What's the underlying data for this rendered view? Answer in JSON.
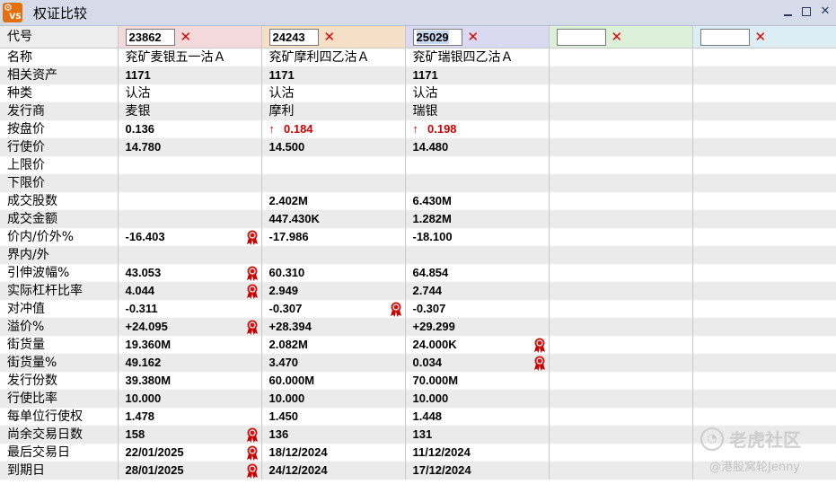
{
  "window": {
    "title": "权证比较",
    "app_icon_text": "VS"
  },
  "codes": [
    {
      "value": "23862",
      "selected": false
    },
    {
      "value": "24243",
      "selected": false
    },
    {
      "value": "25029",
      "selected": true
    },
    {
      "value": "",
      "selected": false
    },
    {
      "value": "",
      "selected": false
    }
  ],
  "code_label": "代号",
  "rows": [
    {
      "label": "名称",
      "type": "txt",
      "cells": [
        "兖矿麦银五一沽Ａ",
        "兖矿摩利四乙沽Ａ",
        "兖矿瑞银四乙沽Ａ",
        "",
        ""
      ]
    },
    {
      "label": "相关资产",
      "type": "val",
      "cells": [
        "1171",
        "1171",
        "1171",
        "",
        ""
      ]
    },
    {
      "label": "种类",
      "type": "txt",
      "cells": [
        "认沽",
        "认沽",
        "认沽",
        "",
        ""
      ]
    },
    {
      "label": "发行商",
      "type": "txt",
      "cells": [
        "麦银",
        "摩利",
        "瑞银",
        "",
        ""
      ]
    },
    {
      "label": "按盘价",
      "type": "val",
      "cells": [
        "0.136",
        "0.184",
        "0.198",
        "",
        ""
      ],
      "arrows": [
        false,
        true,
        true,
        false,
        false
      ],
      "red": [
        false,
        true,
        true,
        false,
        false
      ]
    },
    {
      "label": "行使价",
      "type": "val",
      "cells": [
        "14.780",
        "14.500",
        "14.480",
        "",
        ""
      ]
    },
    {
      "label": "上限价",
      "type": "val",
      "cells": [
        "",
        "",
        "",
        "",
        ""
      ]
    },
    {
      "label": "下限价",
      "type": "val",
      "cells": [
        "",
        "",
        "",
        "",
        ""
      ]
    },
    {
      "label": "成交股数",
      "type": "val",
      "cells": [
        "",
        "2.402M",
        "6.430M",
        "",
        ""
      ]
    },
    {
      "label": "成交金额",
      "type": "val",
      "cells": [
        "",
        "447.430K",
        "1.282M",
        "",
        ""
      ]
    },
    {
      "label": "价内/价外%",
      "type": "val",
      "cells": [
        "-16.403",
        "-17.986",
        "-18.100",
        "",
        ""
      ],
      "badges": [
        true,
        false,
        false,
        false,
        false
      ]
    },
    {
      "label": "界内/外",
      "type": "val",
      "cells": [
        "",
        "",
        "",
        "",
        ""
      ]
    },
    {
      "label": "引伸波幅%",
      "type": "val",
      "cells": [
        "43.053",
        "60.310",
        "64.854",
        "",
        ""
      ],
      "badges": [
        true,
        false,
        false,
        false,
        false
      ]
    },
    {
      "label": "实际杠杆比率",
      "type": "val",
      "cells": [
        "4.044",
        "2.949",
        "2.744",
        "",
        ""
      ],
      "badges": [
        true,
        false,
        false,
        false,
        false
      ]
    },
    {
      "label": "对冲值",
      "type": "val",
      "cells": [
        "-0.311",
        "-0.307",
        "-0.307",
        "",
        ""
      ],
      "badges": [
        false,
        true,
        false,
        false,
        false
      ]
    },
    {
      "label": "溢价%",
      "type": "val",
      "cells": [
        "+24.095",
        "+28.394",
        "+29.299",
        "",
        ""
      ],
      "badges": [
        true,
        false,
        false,
        false,
        false
      ]
    },
    {
      "label": "街货量",
      "type": "val",
      "cells": [
        "19.360M",
        "2.082M",
        "24.000K",
        "",
        ""
      ],
      "badges": [
        false,
        false,
        true,
        false,
        false
      ]
    },
    {
      "label": "街货量%",
      "type": "val",
      "cells": [
        "49.162",
        "3.470",
        "0.034",
        "",
        ""
      ],
      "badges": [
        false,
        false,
        true,
        false,
        false
      ]
    },
    {
      "label": "发行份数",
      "type": "val",
      "cells": [
        "39.380M",
        "60.000M",
        "70.000M",
        "",
        ""
      ]
    },
    {
      "label": "行使比率",
      "type": "val",
      "cells": [
        "10.000",
        "10.000",
        "10.000",
        "",
        ""
      ]
    },
    {
      "label": "每单位行使权",
      "type": "val",
      "cells": [
        "1.478",
        "1.450",
        "1.448",
        "",
        ""
      ]
    },
    {
      "label": "尚余交易日数",
      "type": "val",
      "cells": [
        "158",
        "136",
        "131",
        "",
        ""
      ],
      "badges": [
        true,
        false,
        false,
        false,
        false
      ]
    },
    {
      "label": "最后交易日",
      "type": "val",
      "cells": [
        "22/01/2025",
        "18/12/2024",
        "11/12/2024",
        "",
        ""
      ],
      "badges": [
        true,
        false,
        false,
        false,
        false
      ]
    },
    {
      "label": "到期日",
      "type": "val",
      "cells": [
        "28/01/2025",
        "24/12/2024",
        "17/12/2024",
        "",
        ""
      ],
      "badges": [
        true,
        false,
        false,
        false,
        false
      ]
    }
  ],
  "watermark": {
    "brand": "老虎社区",
    "user": "@港股窝轮Jenny"
  },
  "colors": {
    "header_col1": "#f4d9dc",
    "header_col2": "#f6dfc7",
    "header_col3": "#d9d9f2",
    "header_col4": "#dcf0d9",
    "header_col5": "#dceef4",
    "up_red": "#d10000",
    "clear_x": "#e00000"
  },
  "icons": {
    "up": "up-arrow-icon",
    "badge": "ribbon-award-icon",
    "clear": "close-x-icon"
  }
}
